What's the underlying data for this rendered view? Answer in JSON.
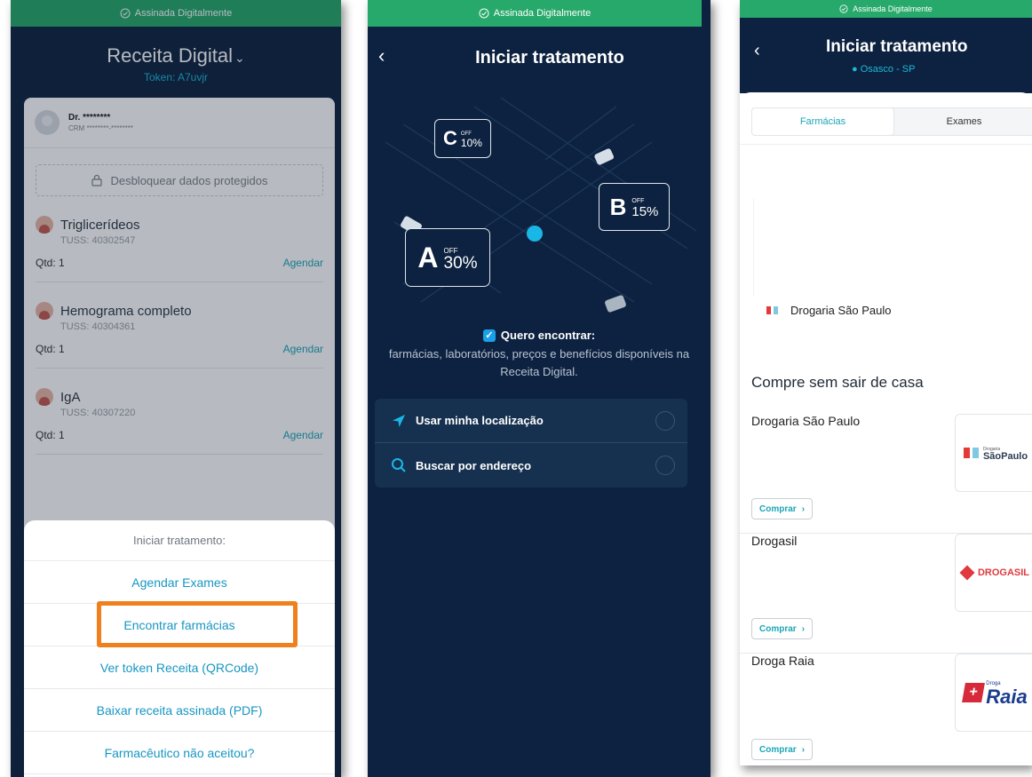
{
  "signed_label": "Assinada Digitalmente",
  "screen1": {
    "title": "Receita Digital",
    "token": "Token: A7uvjr",
    "doctor_name": "Dr. ********",
    "doctor_crm": "CRM ********-********",
    "unlock_label": "Desbloquear dados protegidos",
    "exams": [
      {
        "name": "Triglicerídeos",
        "tuss": "TUSS: 40302547",
        "qtd": "Qtd: 1",
        "action": "Agendar"
      },
      {
        "name": "Hemograma completo",
        "tuss": "TUSS: 40304361",
        "qtd": "Qtd: 1",
        "action": "Agendar"
      },
      {
        "name": "IgA",
        "tuss": "TUSS: 40307220",
        "qtd": "Qtd: 1",
        "action": "Agendar"
      }
    ],
    "sheet": {
      "title": "Iniciar tratamento:",
      "items": [
        "Agendar Exames",
        "Encontrar farmácias",
        "Ver token Receita (QRCode)",
        "Baixar receita assinada (PDF)",
        "Farmacêutico não aceitou?"
      ]
    },
    "highlight_color": "#f07f1d"
  },
  "screen2": {
    "title": "Iniciar tratamento",
    "coupons": [
      {
        "letter": "C",
        "off": "OFF",
        "pct": "10%"
      },
      {
        "letter": "B",
        "off": "OFF",
        "pct": "15%"
      },
      {
        "letter": "A",
        "off": "OFF",
        "pct": "30%"
      }
    ],
    "checkbox_label": "Quero encontrar:",
    "checkbox_sub": "farmácias, laboratórios, preços e benefícios disponíveis na Receita Digital.",
    "options": [
      "Usar minha localização",
      "Buscar por endereço"
    ]
  },
  "screen3": {
    "title": "Iniciar tratamento",
    "location": "Osasco - SP",
    "tabs": [
      "Farmácias",
      "Exames"
    ],
    "map_result": "Drogaria São Paulo",
    "section_title": "Compre sem sair de casa",
    "stores": [
      {
        "name": "Drogaria São Paulo",
        "button": "Comprar",
        "logo_text": "SãoPaulo",
        "logo_small": "Drogaria"
      },
      {
        "name": "Drogasil",
        "button": "Comprar",
        "logo_text": "DROGASIL"
      },
      {
        "name": "Droga Raia",
        "button": "Comprar",
        "logo_text": "Raia",
        "logo_small": "Droga"
      }
    ]
  }
}
